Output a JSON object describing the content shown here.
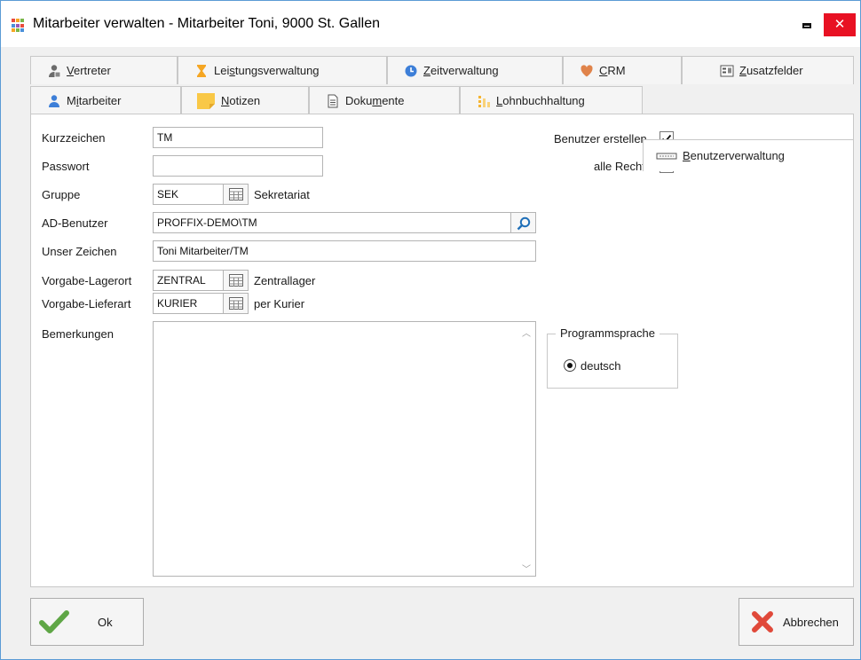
{
  "window": {
    "title": "Mitarbeiter verwalten - Mitarbeiter Toni, 9000 St. Gallen",
    "close_glyph": "✕"
  },
  "tabs_row1": [
    {
      "pre": "",
      "mn": "V",
      "post": "ertreter"
    },
    {
      "pre": "Lei",
      "mn": "s",
      "post": "tungsverwaltung"
    },
    {
      "pre": "",
      "mn": "Z",
      "post": "eitverwaltung"
    },
    {
      "pre": "",
      "mn": "C",
      "post": "RM"
    },
    {
      "pre": "",
      "mn": "Z",
      "post": "usatzfelder"
    }
  ],
  "tabs_row2": [
    {
      "pre": "M",
      "mn": "i",
      "post": "tarbeiter"
    },
    {
      "pre": "",
      "mn": "N",
      "post": "otizen"
    },
    {
      "pre": "Doku",
      "mn": "m",
      "post": "ente"
    },
    {
      "pre": "",
      "mn": "L",
      "post": "ohnbuchhaltung"
    },
    {
      "pre": "",
      "mn": "B",
      "post": "enutzerverwaltung"
    }
  ],
  "form": {
    "kurzzeichen_label": "Kurzzeichen",
    "kurzzeichen_value": "TM",
    "passwort_label": "Passwort",
    "passwort_value": "",
    "gruppe_label": "Gruppe",
    "gruppe_value": "SEK",
    "gruppe_text": "Sekretariat",
    "ad_label": "AD-Benutzer",
    "ad_value": "PROFFIX-DEMO\\TM",
    "zeichen_label": "Unser Zeichen",
    "zeichen_value": "Toni Mitarbeiter/TM",
    "lagerort_label": "Vorgabe-Lagerort",
    "lagerort_value": "ZENTRAL",
    "lagerort_text": "Zentrallager",
    "lieferart_label": "Vorgabe-Lieferart",
    "lieferart_value": "KURIER",
    "lieferart_text": "per Kurier",
    "bemerkungen_label": "Bemerkungen",
    "benutzer_erstellen_label": "Benutzer erstellen",
    "benutzer_erstellen_checked": true,
    "alle_rechte_label": "alle Rechte",
    "alle_rechte_checked": false,
    "programmsprache_label": "Programmsprache",
    "sprache_option": "deutsch"
  },
  "buttons": {
    "ok_label": "Ok",
    "cancel_label": "Abbrechen"
  },
  "colors": {
    "accent": "#5b9bd5",
    "close": "#e81123",
    "ok_check": "#5fa646",
    "cancel_x": "#e0493a"
  }
}
